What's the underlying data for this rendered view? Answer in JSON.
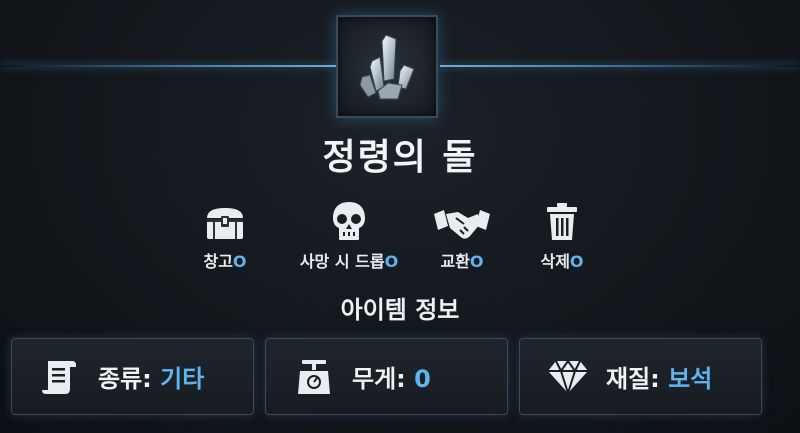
{
  "item": {
    "name": "정령의 돌",
    "icon": "crystal-icon"
  },
  "flags": [
    {
      "label": "창고",
      "value": "O",
      "icon": "chest-icon"
    },
    {
      "label": "사망 시 드롭",
      "value": "O",
      "icon": "skull-icon"
    },
    {
      "label": "교환",
      "value": "O",
      "icon": "handshake-icon"
    },
    {
      "label": "삭제",
      "value": "O",
      "icon": "trash-icon"
    }
  ],
  "section_title": "아이템 정보",
  "info": [
    {
      "label": "종류: ",
      "value": "기타",
      "icon": "scroll-icon"
    },
    {
      "label": "무게: ",
      "value": "0",
      "icon": "scale-icon"
    },
    {
      "label": "재질: ",
      "value": "보석",
      "icon": "gem-icon"
    }
  ],
  "colors": {
    "accent": "#5fb4f0",
    "glow": "#50aaf0",
    "background": "#12161b"
  }
}
